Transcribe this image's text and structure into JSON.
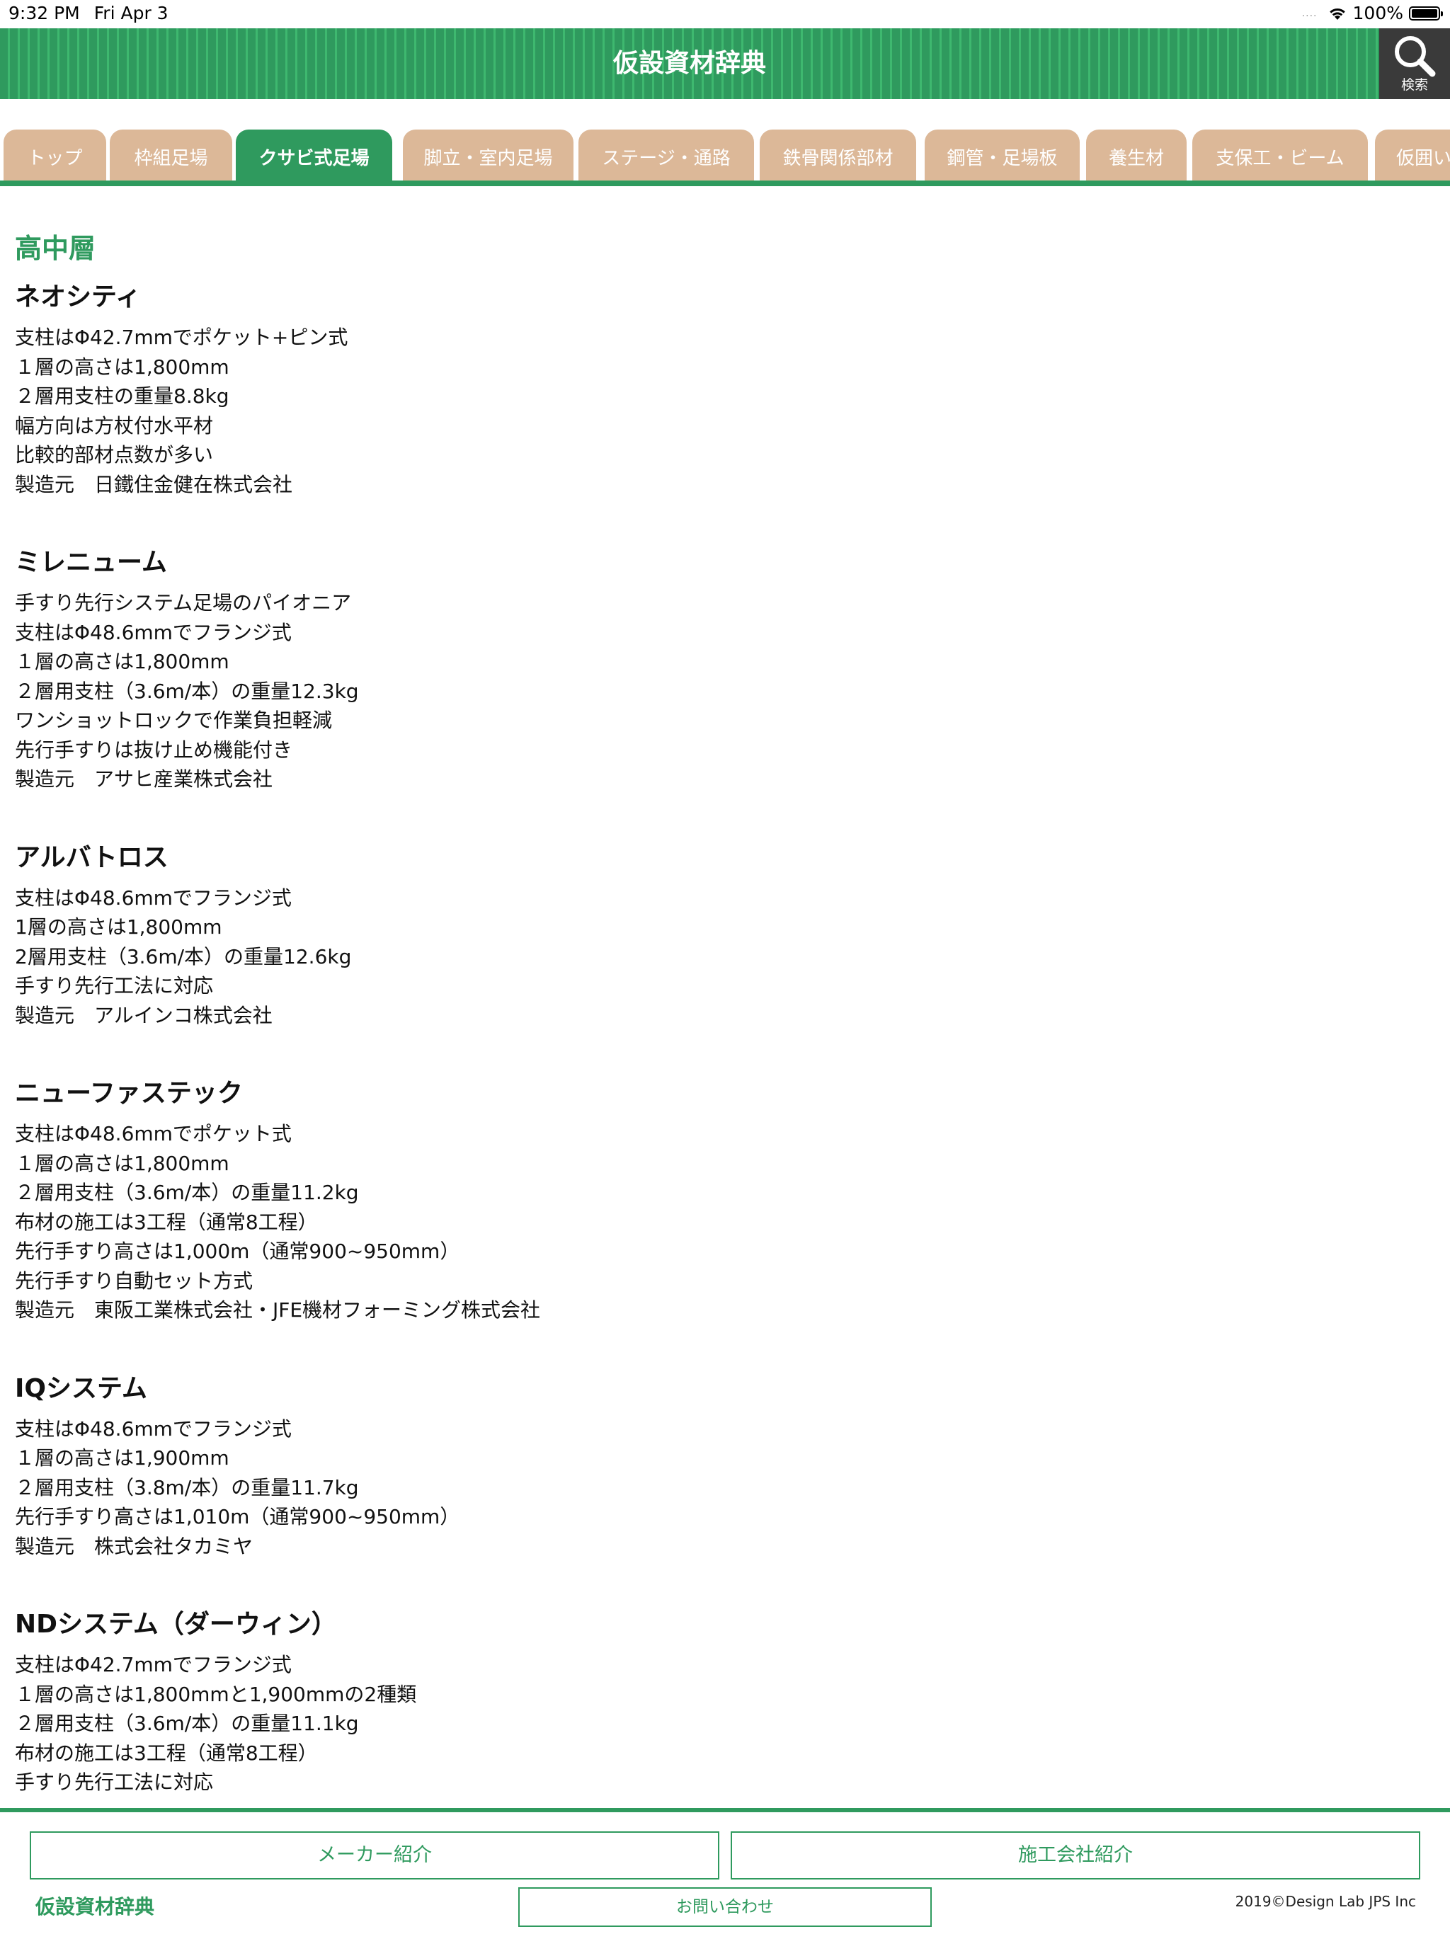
{
  "status_bar": {
    "time": "9:32 PM",
    "date": "Fri Apr 3",
    "battery": "100%",
    "battery_level": 1.0,
    "signal_dots": "....",
    "wifi_icon": "wifi-icon"
  },
  "header": {
    "title": "仮設資材辞典",
    "search_label": "検索",
    "search_icon": "magnifier-icon",
    "colors": {
      "green": "#2f9a5e",
      "light_green": "#3eb86f",
      "search_bg": "#3a3a3a"
    }
  },
  "tabs": {
    "items": [
      {
        "label": "トップ"
      },
      {
        "label": "枠組足場"
      },
      {
        "label": "クサビ式足場",
        "active": true
      },
      {
        "label": "脚立・室内足場"
      },
      {
        "label": "ステージ・通路"
      },
      {
        "label": "鉄骨関係部材"
      },
      {
        "label": "鋼管・足場板"
      },
      {
        "label": "養生材"
      },
      {
        "label": "支保工・ビーム"
      },
      {
        "label": "仮囲い"
      }
    ],
    "colors": {
      "inactive": "#dcb898",
      "active": "#2f9a5e"
    }
  },
  "main": {
    "section_title": "高中層",
    "items": [
      {
        "title": "ネオシティ",
        "lines": [
          "支柱はΦ42.7mmでポケット+ピン式",
          "１層の高さは1,800mm",
          "２層用支柱の重量8.8kg",
          "幅方向は方杖付水平材",
          "比較的部材点数が多い",
          "製造元　日鐵住金健在株式会社"
        ]
      },
      {
        "title": "ミレニューム",
        "lines": [
          "手すり先行システム足場のパイオニア",
          "支柱はΦ48.6mmでフランジ式",
          "１層の高さは1,800mm",
          "２層用支柱（3.6m/本）の重量12.3kg",
          "ワンショットロックで作業負担軽減",
          "先行手すりは抜け止め機能付き",
          "製造元　アサヒ産業株式会社"
        ]
      },
      {
        "title": "アルバトロス",
        "lines": [
          "支柱はΦ48.6mmでフランジ式",
          "1層の高さは1,800mm",
          "2層用支柱（3.6m/本）の重量12.6kg",
          "手すり先行工法に対応",
          "製造元　アルインコ株式会社"
        ]
      },
      {
        "title": "ニューファステック",
        "lines": [
          "支柱はΦ48.6mmでポケット式",
          "１層の高さは1,800mm",
          "２層用支柱（3.6m/本）の重量11.2kg",
          "布材の施工は3工程（通常8工程）",
          "先行手すり高さは1,000m（通常900~950mm）",
          "先行手すり自動セット方式",
          "製造元　東阪工業株式会社・JFE機材フォーミング株式会社"
        ]
      },
      {
        "title": "IQシステム",
        "lines": [
          "支柱はΦ48.6mmでフランジ式",
          "１層の高さは1,900mm",
          "２層用支柱（3.8m/本）の重量11.7kg",
          "先行手すり高さは1,010m（通常900~950mm）",
          "製造元　株式会社タカミヤ"
        ]
      },
      {
        "title": "NDシステム（ダーウィン）",
        "lines": [
          "支柱はΦ42.7mmでフランジ式",
          "１層の高さは1,800mmと1,900mmの2種類",
          "２層用支柱（3.6m/本）の重量11.1kg",
          "布材の施工は3工程（通常8工程）",
          "手すり先行工法に対応"
        ]
      }
    ]
  },
  "footer": {
    "maker_button": "メーカー紹介",
    "contractor_button": "施工会社紹介",
    "contact_button": "お問い合わせ",
    "logo_text": "仮設資材辞典",
    "copyright": "2019©Design Lab JPS Inc"
  }
}
